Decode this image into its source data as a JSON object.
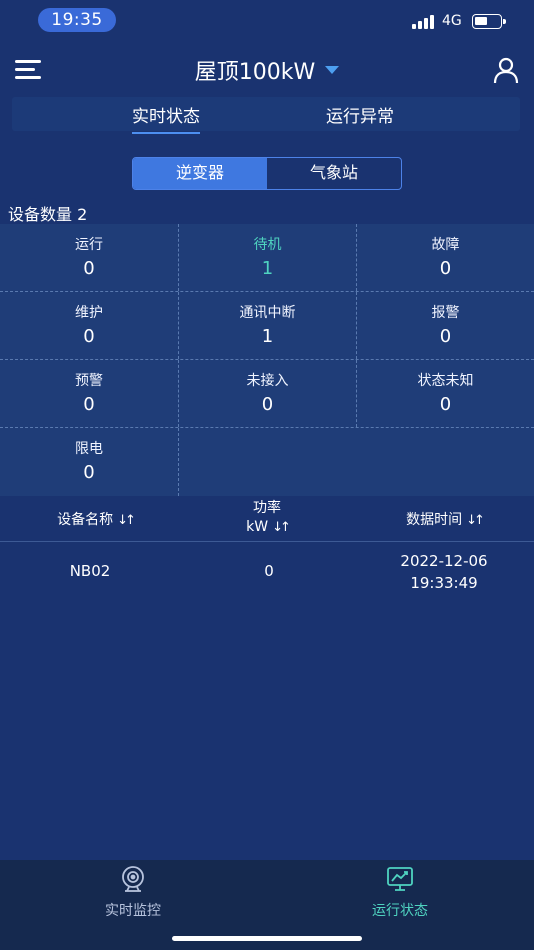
{
  "status_bar": {
    "time": "19:35",
    "network": "4G"
  },
  "header": {
    "title": "屋顶100kW"
  },
  "top_tabs": [
    {
      "label": "实时状态",
      "active": true
    },
    {
      "label": "运行异常",
      "active": false
    }
  ],
  "segment": [
    {
      "label": "逆变器",
      "active": true
    },
    {
      "label": "气象站",
      "active": false
    }
  ],
  "device_count_label": "设备数量 2",
  "status_grid": [
    {
      "label": "运行",
      "value": "0"
    },
    {
      "label": "待机",
      "value": "1"
    },
    {
      "label": "故障",
      "value": "0"
    },
    {
      "label": "维护",
      "value": "0"
    },
    {
      "label": "通讯中断",
      "value": "1"
    },
    {
      "label": "报警",
      "value": "0"
    },
    {
      "label": "预警",
      "value": "0"
    },
    {
      "label": "未接入",
      "value": "0"
    },
    {
      "label": "状态未知",
      "value": "0"
    },
    {
      "label": "限电",
      "value": "0"
    }
  ],
  "table": {
    "headers": {
      "name": "设备名称",
      "power_line1": "功率",
      "power_line2": "kW",
      "time": "数据时间",
      "sort_glyph": "↓↑"
    },
    "rows": [
      {
        "name": "NB02",
        "power": "0",
        "date": "2022-12-06",
        "time": "19:33:49"
      }
    ]
  },
  "bottom_nav": [
    {
      "label": "实时监控",
      "icon": "camera-icon",
      "active": false
    },
    {
      "label": "运行状态",
      "icon": "monitor-chart-icon",
      "active": true
    }
  ],
  "colors": {
    "background": "#1a3370",
    "accent": "#3f78e0",
    "teal": "#4fd3c0",
    "nav_bg": "#15294f"
  }
}
